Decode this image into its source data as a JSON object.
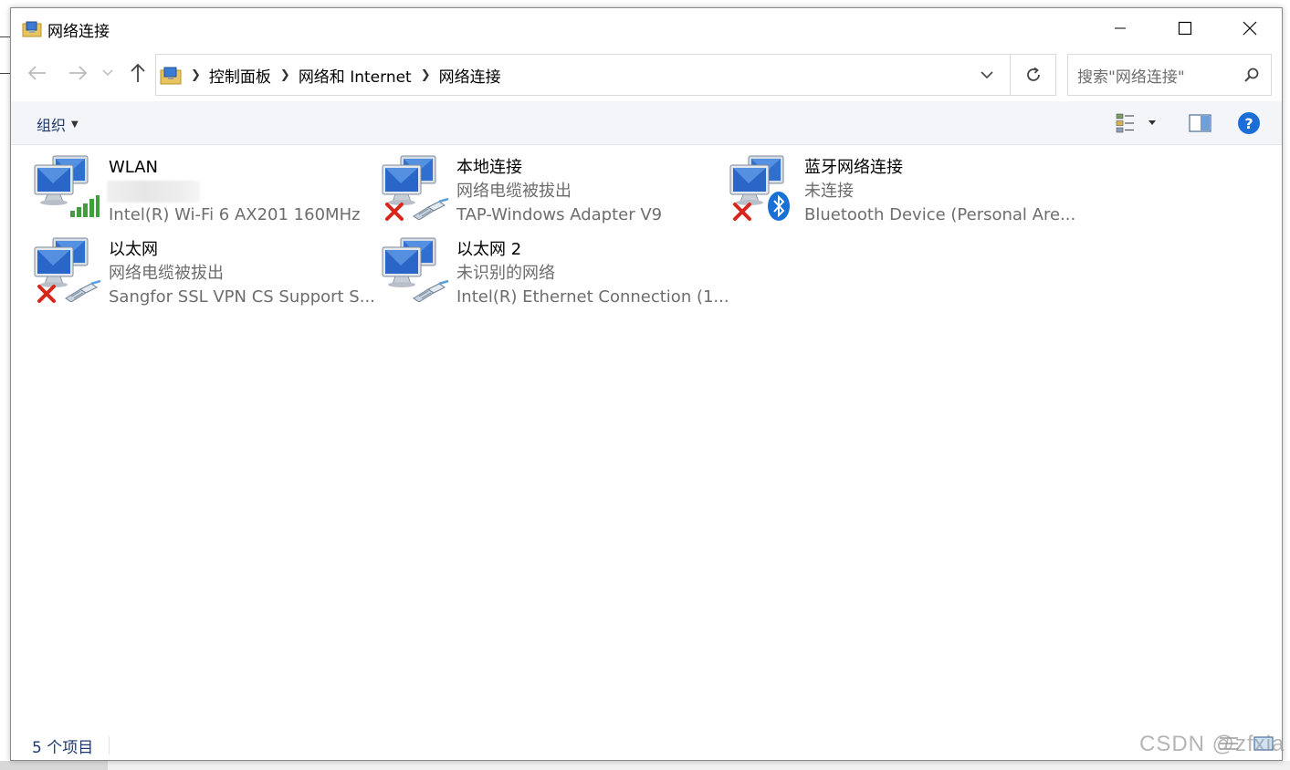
{
  "window": {
    "title": "网络连接",
    "minimize_label": "—",
    "maximize_label": "☐",
    "close_label": "✕"
  },
  "nav": {
    "breadcrumb": [
      "控制面板",
      "网络和 Internet",
      "网络连接"
    ],
    "search_placeholder": "搜索\"网络连接\""
  },
  "command_bar": {
    "organize_label": "组织"
  },
  "connections": [
    {
      "name": "WLAN",
      "status": "",
      "status_blurred": true,
      "device": "Intel(R) Wi-Fi 6 AX201 160MHz",
      "badge": "wifi-signal",
      "disconnected": false
    },
    {
      "name": "本地连接",
      "status": "网络电缆被拔出",
      "device": "TAP-Windows Adapter V9",
      "badge": "ethernet-cable",
      "disconnected": true
    },
    {
      "name": "蓝牙网络连接",
      "status": "未连接",
      "device": "Bluetooth Device (Personal Are...",
      "badge": "bluetooth",
      "disconnected": true
    },
    {
      "name": "以太网",
      "status": "网络电缆被拔出",
      "device": "Sangfor SSL VPN CS Support S...",
      "badge": "ethernet-cable",
      "disconnected": true
    },
    {
      "name": "以太网 2",
      "status": "未识别的网络",
      "device": "Intel(R) Ethernet Connection (1...",
      "badge": "ethernet-cable",
      "disconnected": false
    }
  ],
  "status_bar": {
    "item_count": "5 个项目"
  },
  "watermark": "CSDN @zfxia",
  "colors": {
    "accent_text": "#1e3a6e",
    "help_blue": "#1b6ed8",
    "error_red": "#d9261c",
    "wifi_green": "#3f9f3f",
    "bluetooth_blue": "#1872d6"
  }
}
